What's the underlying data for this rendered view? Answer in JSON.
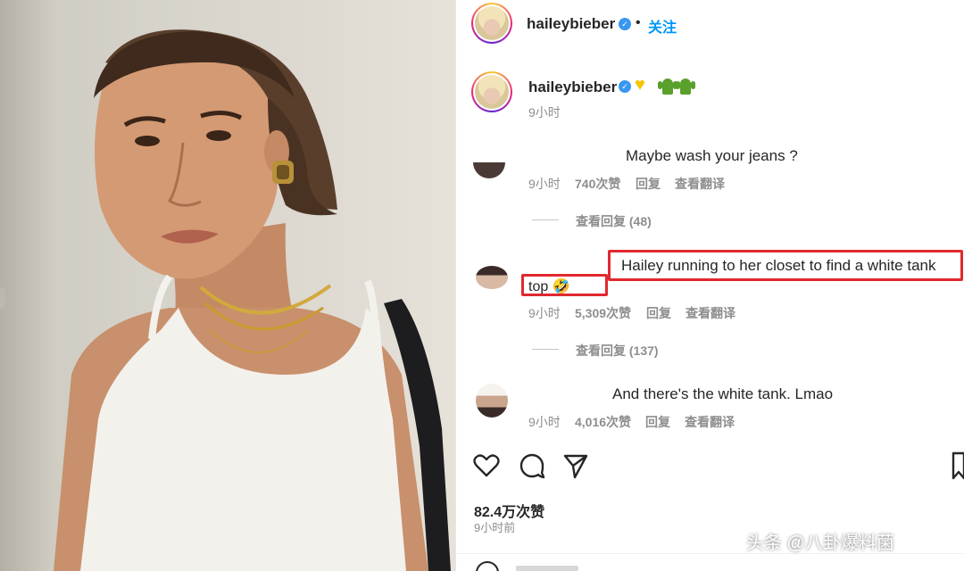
{
  "post": {
    "header_username": "haileybieber",
    "follow_label": "关注",
    "separator": "•",
    "caption_username": "haileybieber",
    "caption_time": "9小时",
    "caption_emojis": [
      "yellow-heart",
      "cactus",
      "cactus"
    ]
  },
  "comments": [
    {
      "text": "Maybe wash your jeans ?",
      "time": "9小时",
      "likes": "740次赞",
      "reply": "回复",
      "translate": "查看翻译",
      "view_replies": "查看回复 (48)"
    },
    {
      "text_line1": "Hailey running to her closet to find a white tank",
      "text_line2": "top 🤣",
      "time": "9小时",
      "likes": "5,309次赞",
      "reply": "回复",
      "translate": "查看翻译",
      "view_replies": "查看回复 (137)",
      "highlight_color": "#e0282f"
    },
    {
      "text": "And there's the white tank. Lmao",
      "time": "9小时",
      "likes": "4,016次赞",
      "reply": "回复",
      "translate": "查看翻译"
    }
  ],
  "actions": {
    "icons": [
      "heart-icon",
      "comment-icon",
      "share-icon"
    ]
  },
  "stats": {
    "likes": "82.4万次赞",
    "posted": "9小时前"
  },
  "watermark": "头条 @八卦爆料菌",
  "colors": {
    "link": "#0095f6",
    "verified": "#3897f0",
    "highlight": "#e0282f"
  }
}
